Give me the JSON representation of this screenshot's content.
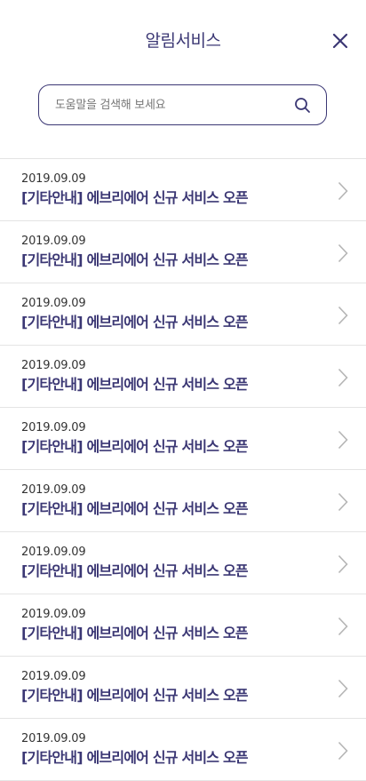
{
  "header": {
    "title": "알림서비스",
    "close_icon": "close-icon"
  },
  "search": {
    "placeholder": "도움말을 검색해 보세요",
    "value": "",
    "icon": "search-icon"
  },
  "colors": {
    "accent": "#3b3774",
    "divider": "#e4e4e4",
    "chevron": "#b5b5b5"
  },
  "notices": [
    {
      "date": "2019.09.09",
      "title": "[기타안내] 에브리에어 신규 서비스 오픈"
    },
    {
      "date": "2019.09.09",
      "title": "[기타안내] 에브리에어 신규 서비스 오픈"
    },
    {
      "date": "2019.09.09",
      "title": "[기타안내] 에브리에어 신규 서비스 오픈"
    },
    {
      "date": "2019.09.09",
      "title": "[기타안내] 에브리에어 신규 서비스 오픈"
    },
    {
      "date": "2019.09.09",
      "title": "[기타안내] 에브리에어 신규 서비스 오픈"
    },
    {
      "date": "2019.09.09",
      "title": "[기타안내] 에브리에어 신규 서비스 오픈"
    },
    {
      "date": "2019.09.09",
      "title": "[기타안내] 에브리에어 신규 서비스 오픈"
    },
    {
      "date": "2019.09.09",
      "title": "[기타안내] 에브리에어 신규 서비스 오픈"
    },
    {
      "date": "2019.09.09",
      "title": "[기타안내] 에브리에어 신규 서비스 오픈"
    },
    {
      "date": "2019.09.09",
      "title": "[기타안내] 에브리에어 신규 서비스 오픈"
    }
  ]
}
